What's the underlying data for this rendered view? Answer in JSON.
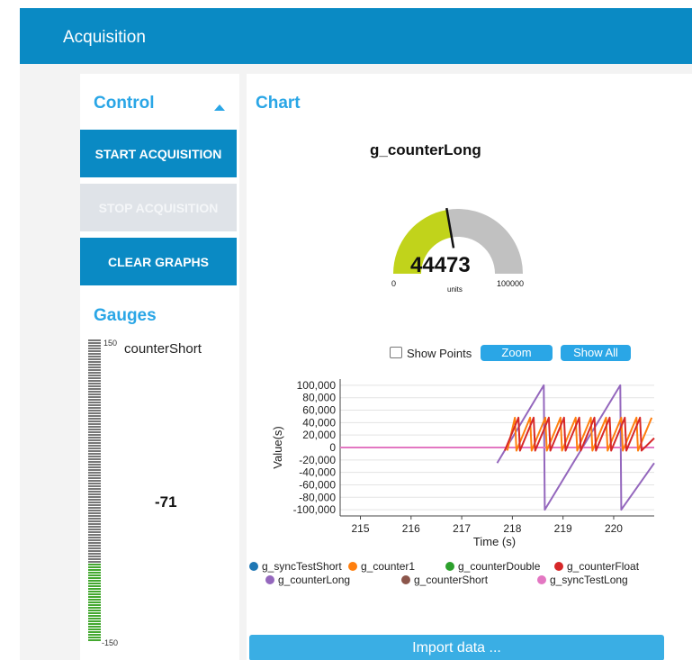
{
  "header": {
    "title": "Acquisition"
  },
  "control": {
    "title": "Control",
    "start_label": "START ACQUISITION",
    "stop_label": "STOP ACQUISITION",
    "clear_label": "CLEAR GRAPHS"
  },
  "gauges": {
    "title": "Gauges",
    "bar": {
      "name": "counterShort",
      "max": "150",
      "min": "-150",
      "value": "-71",
      "fill_fraction": 0.263
    },
    "colors": {
      "filled": "#43a82f",
      "empty": "#777777"
    }
  },
  "chart": {
    "title": "Chart",
    "gauge": {
      "name": "g_counterLong",
      "value": "44473",
      "min": "0",
      "max": "100000",
      "units": "units",
      "fraction": 0.445,
      "colors": {
        "filled": "#c1d31b",
        "empty": "#c1c1c1"
      }
    },
    "show_points_label": "Show Points",
    "zoom_label": "Zoom",
    "show_all_label": "Show All",
    "import_label": "Import data ..."
  },
  "chart_data": {
    "type": "line",
    "title": "",
    "xlabel": "Time (s)",
    "ylabel": "Value(s)",
    "xlim": [
      214.6,
      220.8
    ],
    "ylim": [
      -110000,
      110000
    ],
    "xticks": [
      "215",
      "216",
      "217",
      "218",
      "219",
      "220"
    ],
    "yticks": [
      "100,000",
      "80,000",
      "60,000",
      "40,000",
      "20,000",
      "0",
      "-20,000",
      "-40,000",
      "-60,000",
      "-80,000",
      "-100,000"
    ],
    "series": [
      {
        "name": "g_syncTestShort",
        "color": "#1f77b4",
        "x": [
          214.6,
          220.8
        ],
        "y": [
          0,
          0
        ]
      },
      {
        "name": "g_counter1",
        "color": "#ff7f0e",
        "x": [
          217.9,
          218.05,
          218.08,
          218.35,
          218.38,
          218.65,
          218.68,
          218.95,
          218.98,
          219.25,
          219.28,
          219.55,
          219.58,
          219.85,
          219.88,
          220.15,
          220.18,
          220.45,
          220.48,
          220.75
        ],
        "y": [
          -5000,
          48000,
          -5000,
          48000,
          -5000,
          48000,
          -5000,
          48000,
          -5000,
          48000,
          -5000,
          48000,
          -5000,
          48000,
          -5000,
          48000,
          -5000,
          48000,
          -5000,
          48000
        ]
      },
      {
        "name": "g_counterDouble",
        "color": "#2ca02c",
        "x": [
          214.6,
          220.8
        ],
        "y": [
          0,
          0
        ]
      },
      {
        "name": "g_counterFloat",
        "color": "#d62728",
        "x": [
          217.85,
          218.12,
          218.15,
          218.42,
          218.45,
          218.72,
          218.75,
          219.02,
          219.05,
          219.32,
          219.35,
          219.62,
          219.65,
          219.92,
          219.95,
          220.22,
          220.25,
          220.52,
          220.55,
          220.8
        ],
        "y": [
          -5000,
          48000,
          -5000,
          48000,
          -5000,
          48000,
          -5000,
          48000,
          -5000,
          48000,
          -5000,
          48000,
          -5000,
          48000,
          -5000,
          48000,
          -5000,
          48000,
          -5000,
          15000
        ]
      },
      {
        "name": "g_counterLong",
        "color": "#9467bd",
        "x": [
          217.7,
          218.62,
          218.64,
          220.13,
          220.15,
          220.8
        ],
        "y": [
          -25000,
          100000,
          -100000,
          100000,
          -100000,
          -25000
        ]
      },
      {
        "name": "g_counterShort",
        "color": "#8c564b",
        "x": [
          214.6,
          220.8
        ],
        "y": [
          0,
          0
        ]
      },
      {
        "name": "g_syncTestLong",
        "color": "#e377c2",
        "x": [
          214.6,
          220.8
        ],
        "y": [
          0,
          0
        ]
      }
    ],
    "grid": true,
    "legend": "bottom"
  }
}
